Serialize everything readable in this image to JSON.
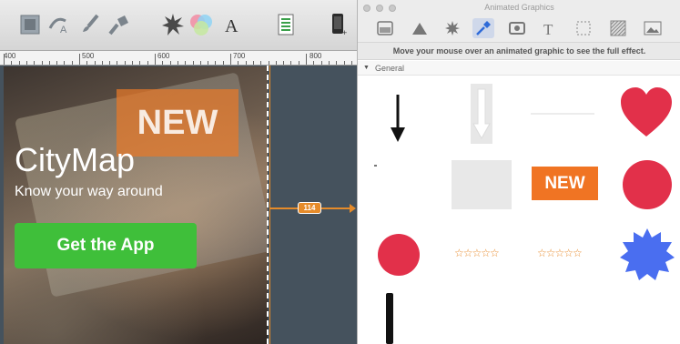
{
  "editor": {
    "ruler_labels": [
      "400",
      "500",
      "600",
      "700",
      "800"
    ],
    "artboard": {
      "badge_text": "NEW",
      "app_title": "CityMap",
      "app_tagline": "Know your way around",
      "cta_label": "Get the App"
    },
    "measure_value": "114",
    "toolbar_icons": [
      "artboard-icon",
      "text-on-path-icon",
      "brush-icon",
      "paint-tool-icon",
      "burst-effect-icon",
      "color-wheel-icon",
      "text-tool-icon",
      "document-icon",
      "device-preview-icon"
    ]
  },
  "palette": {
    "window_title": "Animated Graphics",
    "categories": [
      "panel-icon",
      "triangle-icon",
      "burst-icon",
      "eyedropper-icon",
      "photo-frame-icon",
      "text-icon",
      "selection-icon",
      "pattern-icon",
      "image-icon"
    ],
    "selected_category": "eyedropper-icon",
    "hint": "Move your mouse over an animated graphic to see the full effect.",
    "section_label": "General",
    "items": {
      "new_badge": "NEW"
    },
    "colors": {
      "heart": "#e2304a",
      "circle": "#e2304a",
      "star_burst": "#4a6ef0",
      "orange": "#f07423"
    }
  }
}
